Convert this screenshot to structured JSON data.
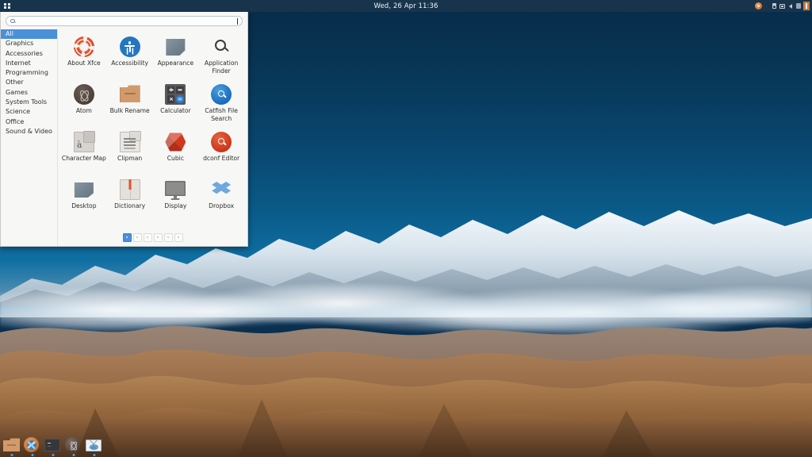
{
  "panel": {
    "menu_button_icon": "grid-icon",
    "clock": "Wed, 26 Apr 11:36",
    "tray": [
      {
        "name": "software-updater-icon",
        "label": "Software Updater"
      },
      {
        "name": "battery-icon",
        "label": "Battery"
      },
      {
        "name": "network-icon",
        "label": "Network"
      },
      {
        "name": "volume-icon",
        "label": "Volume"
      },
      {
        "name": "indicator-icon",
        "label": "Indicator"
      },
      {
        "name": "session-icon",
        "label": "Session"
      }
    ]
  },
  "whisker": {
    "search": {
      "value": "",
      "placeholder": ""
    },
    "categories": [
      {
        "label": "All",
        "active": true
      },
      {
        "label": "Graphics",
        "active": false
      },
      {
        "label": "Accessories",
        "active": false
      },
      {
        "label": "Internet",
        "active": false
      },
      {
        "label": "Programming",
        "active": false
      },
      {
        "label": "Other",
        "active": false
      },
      {
        "label": "Games",
        "active": false
      },
      {
        "label": "System Tools",
        "active": false
      },
      {
        "label": "Science",
        "active": false
      },
      {
        "label": "Office",
        "active": false
      },
      {
        "label": "Sound & Video",
        "active": false
      }
    ],
    "apps": [
      {
        "label": "About Xfce",
        "icon": "lifebuoy-icon"
      },
      {
        "label": "Accessibility",
        "icon": "accessibility-icon"
      },
      {
        "label": "Appearance",
        "icon": "appearance-icon"
      },
      {
        "label": "Application Finder",
        "icon": "magnifier-icon"
      },
      {
        "label": "Atom",
        "icon": "atom-icon"
      },
      {
        "label": "Bulk Rename",
        "icon": "folder-icon"
      },
      {
        "label": "Calculator",
        "icon": "calculator-icon"
      },
      {
        "label": "Catfish File Search",
        "icon": "catfish-search-icon"
      },
      {
        "label": "Character Map",
        "icon": "character-map-icon"
      },
      {
        "label": "Clipman",
        "icon": "clipboard-icon"
      },
      {
        "label": "Cubic",
        "icon": "cube-icon"
      },
      {
        "label": "dconf Editor",
        "icon": "dconf-icon"
      },
      {
        "label": "Desktop",
        "icon": "desktop-icon"
      },
      {
        "label": "Dictionary",
        "icon": "book-icon"
      },
      {
        "label": "Display",
        "icon": "monitor-icon"
      },
      {
        "label": "Dropbox",
        "icon": "dropbox-icon"
      }
    ],
    "pages": [
      {
        "index": 1,
        "active": true
      },
      {
        "index": 2,
        "active": false
      },
      {
        "index": 3,
        "active": false
      },
      {
        "index": 4,
        "active": false
      },
      {
        "index": 5,
        "active": false
      },
      {
        "index": 6,
        "active": false
      }
    ]
  },
  "dock": {
    "items": [
      {
        "name": "file-manager-icon",
        "label": "File Manager",
        "running": true
      },
      {
        "name": "web-browser-icon",
        "label": "Web Browser",
        "running": true
      },
      {
        "name": "terminal-icon",
        "label": "Terminal",
        "running": true
      },
      {
        "name": "atom-editor-icon",
        "label": "Atom",
        "running": true
      },
      {
        "name": "mail-client-icon",
        "label": "Mail",
        "running": true
      }
    ]
  },
  "colors": {
    "panel_bg": "#18344d",
    "accent_blue": "#4a90d9",
    "sky_top": "#072b49",
    "sky_bottom": "#0f6fa2",
    "terrain": "#8a6043"
  }
}
